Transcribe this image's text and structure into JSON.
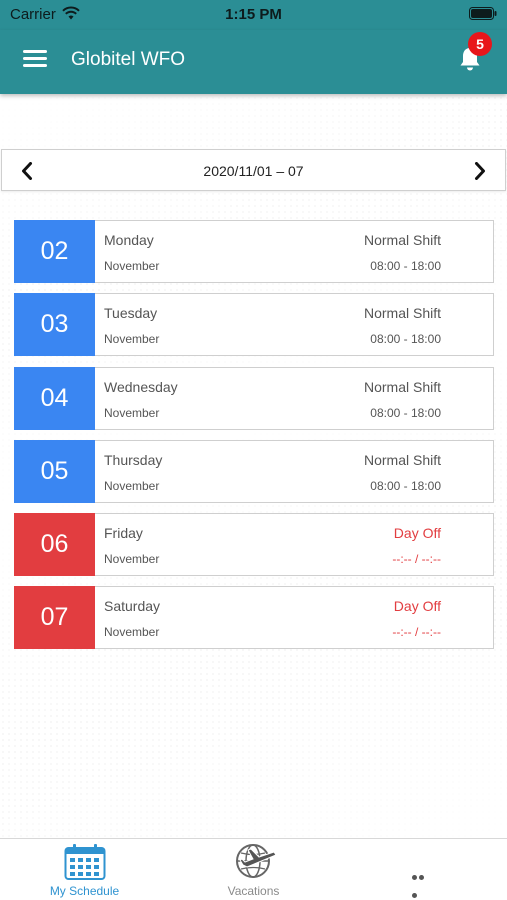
{
  "status_bar": {
    "carrier": "Carrier",
    "time": "1:15 PM"
  },
  "header": {
    "title": "Globitel WFO",
    "notification_count": "5"
  },
  "week": {
    "label": "2020/11/01 – 07"
  },
  "days": [
    {
      "number": "02",
      "name": "Monday",
      "month": "November",
      "shift": "Normal Shift",
      "hours": "08:00 - 18:00",
      "type": "work"
    },
    {
      "number": "03",
      "name": "Tuesday",
      "month": "November",
      "shift": "Normal Shift",
      "hours": "08:00 - 18:00",
      "type": "work"
    },
    {
      "number": "04",
      "name": "Wednesday",
      "month": "November",
      "shift": "Normal Shift",
      "hours": "08:00 - 18:00",
      "type": "work"
    },
    {
      "number": "05",
      "name": "Thursday",
      "month": "November",
      "shift": "Normal Shift",
      "hours": "08:00 - 18:00",
      "type": "work"
    },
    {
      "number": "06",
      "name": "Friday",
      "month": "November",
      "shift": "Day Off",
      "hours": "--:-- / --:--",
      "type": "off"
    },
    {
      "number": "07",
      "name": "Saturday",
      "month": "November",
      "shift": "Day Off",
      "hours": "--:-- / --:--",
      "type": "off"
    }
  ],
  "tabs": [
    {
      "label": "My Schedule",
      "icon": "calendar-icon",
      "active": true
    },
    {
      "label": "Vacations",
      "icon": "plane-globe-icon",
      "active": false
    },
    {
      "label": "",
      "icon": "more-dots-icon",
      "active": false
    }
  ],
  "colors": {
    "header": "#2b8e95",
    "work_day": "#3a86f2",
    "day_off": "#e23d40",
    "badge": "#e8161b",
    "active_tab": "#2f93d0"
  }
}
